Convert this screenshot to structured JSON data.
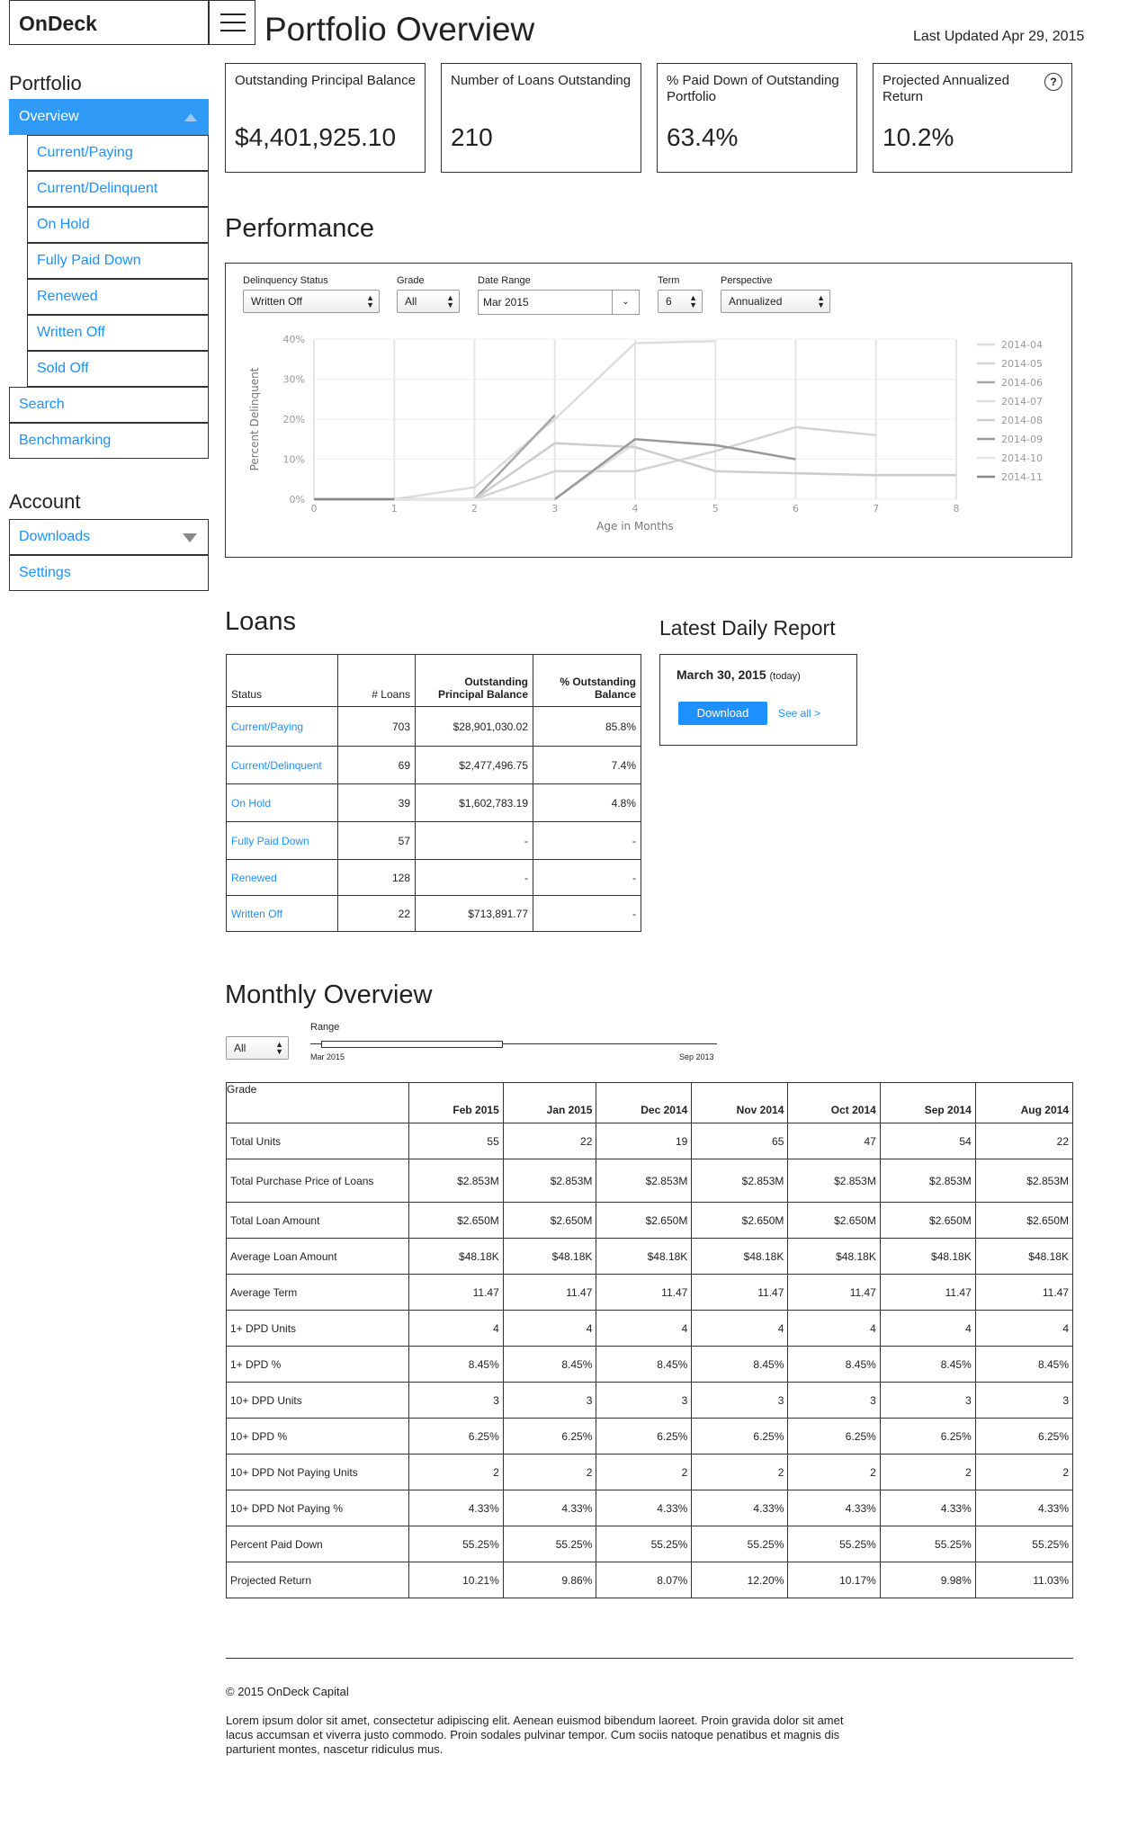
{
  "header": {
    "logo": "OnDeck",
    "title": "Portfolio Overview",
    "last_updated": "Last Updated Apr 29, 2015"
  },
  "sidebar": {
    "portfolio_heading": "Portfolio",
    "overview": "Overview",
    "sub_items": [
      "Current/Paying",
      "Current/Delinquent",
      "On Hold",
      "Fully Paid Down",
      "Renewed",
      "Written Off",
      "Sold Off"
    ],
    "search": "Search",
    "benchmarking": "Benchmarking",
    "account_heading": "Account",
    "downloads": "Downloads",
    "settings": "Settings"
  },
  "metrics": [
    {
      "label": "Outstanding Principal Balance",
      "value": "$4,401,925.10"
    },
    {
      "label": "Number of Loans Outstanding",
      "value": "210"
    },
    {
      "label": "% Paid Down of Outstanding Portfolio",
      "value": "63.4%"
    },
    {
      "label": "Projected Annualized Return",
      "value": "10.2%"
    }
  ],
  "help_glyph": "?",
  "performance": {
    "title": "Performance",
    "filters": {
      "delinquency_label": "Delinquency Status",
      "delinquency_value": "Written Off",
      "grade_label": "Grade",
      "grade_value": "All",
      "date_label": "Date Range",
      "date_value": "Mar 2015",
      "term_label": "Term",
      "term_value": "6",
      "perspective_label": "Perspective",
      "perspective_value": "Annualized"
    }
  },
  "chart_data": {
    "type": "line",
    "xlabel": "Age in Months",
    "ylabel": "Percent Delinquent",
    "x": [
      0,
      1,
      2,
      3,
      4,
      5,
      6,
      7,
      8
    ],
    "xlim": [
      0,
      8
    ],
    "ylim": [
      0,
      40
    ],
    "yticks": [
      "0%",
      "10%",
      "20%",
      "30%",
      "40%"
    ],
    "grid": true,
    "legend": "right",
    "series": [
      {
        "name": "2014-04",
        "color": "#dddddd",
        "values": [
          0,
          0,
          3,
          20,
          39,
          39.5
        ]
      },
      {
        "name": "2014-05",
        "color": "#d4d4d4",
        "values": [
          0,
          0,
          0,
          7,
          7,
          12,
          18,
          16
        ]
      },
      {
        "name": "2014-06",
        "color": "#a8a8a8",
        "values": [
          0,
          0,
          0,
          21
        ]
      },
      {
        "name": "2014-07",
        "color": "#e0e0e0",
        "values": [
          0,
          0,
          0,
          0,
          14
        ]
      },
      {
        "name": "2014-08",
        "color": "#cccccc",
        "values": [
          0,
          0,
          0,
          14,
          13,
          7,
          6.5,
          6,
          6
        ]
      },
      {
        "name": "2014-09",
        "color": "#999999",
        "values": [
          0,
          0,
          0,
          0,
          15,
          13.5,
          10
        ]
      },
      {
        "name": "2014-10",
        "color": "#e6e6e6",
        "values": [
          0,
          0,
          0,
          0
        ]
      },
      {
        "name": "2014-11",
        "color": "#888888",
        "values": [
          0,
          0
        ]
      }
    ]
  },
  "loans": {
    "title": "Loans",
    "headers": [
      "Status",
      "# Loans",
      "Outstanding Principal Balance",
      "% Outstanding Balance"
    ],
    "rows": [
      [
        "Current/Paying",
        "703",
        "$28,901,030.02",
        "85.8%"
      ],
      [
        "Current/Delinquent",
        "69",
        "$2,477,496.75",
        "7.4%"
      ],
      [
        "On Hold",
        "39",
        "$1,602,783.19",
        "4.8%"
      ],
      [
        "Fully Paid Down",
        "57",
        "-",
        "-"
      ],
      [
        "Renewed",
        "128",
        "-",
        "-"
      ],
      [
        "Written Off",
        "22",
        "$713,891.77",
        "-"
      ]
    ]
  },
  "daily_report": {
    "title": "Latest Daily Report",
    "date": "March 30, 2015",
    "today": "(today)",
    "download": "Download",
    "see_all": "See all >"
  },
  "monthly": {
    "title": "Monthly Overview",
    "grade_select": "All",
    "range_label": "Range",
    "range_start": "Mar 2015",
    "range_end": "Sep 2013",
    "range_selected_fraction": 0.48,
    "grade_header": "Grade",
    "months": [
      "Feb 2015",
      "Jan 2015",
      "Dec 2014",
      "Nov 2014",
      "Oct 2014",
      "Sep 2014",
      "Aug 2014"
    ],
    "rows": [
      {
        "label": "Total Units",
        "values": [
          "55",
          "22",
          "19",
          "65",
          "47",
          "54",
          "22"
        ]
      },
      {
        "label": "Total Purchase Price of Loans",
        "values": [
          "$2.853M",
          "$2.853M",
          "$2.853M",
          "$2.853M",
          "$2.853M",
          "$2.853M",
          "$2.853M"
        ]
      },
      {
        "label": "Total Loan Amount",
        "values": [
          "$2.650M",
          "$2.650M",
          "$2.650M",
          "$2.650M",
          "$2.650M",
          "$2.650M",
          "$2.650M"
        ]
      },
      {
        "label": "Average Loan Amount",
        "values": [
          "$48.18K",
          "$48.18K",
          "$48.18K",
          "$48.18K",
          "$48.18K",
          "$48.18K",
          "$48.18K"
        ]
      },
      {
        "label": "Average Term",
        "values": [
          "11.47",
          "11.47",
          "11.47",
          "11.47",
          "11.47",
          "11.47",
          "11.47"
        ]
      },
      {
        "label": "1+ DPD Units",
        "values": [
          "4",
          "4",
          "4",
          "4",
          "4",
          "4",
          "4"
        ]
      },
      {
        "label": "1+ DPD %",
        "values": [
          "8.45%",
          "8.45%",
          "8.45%",
          "8.45%",
          "8.45%",
          "8.45%",
          "8.45%"
        ]
      },
      {
        "label": "10+ DPD Units",
        "values": [
          "3",
          "3",
          "3",
          "3",
          "3",
          "3",
          "3"
        ]
      },
      {
        "label": "10+ DPD %",
        "values": [
          "6.25%",
          "6.25%",
          "6.25%",
          "6.25%",
          "6.25%",
          "6.25%",
          "6.25%"
        ]
      },
      {
        "label": "10+ DPD Not Paying Units",
        "values": [
          "2",
          "2",
          "2",
          "2",
          "2",
          "2",
          "2"
        ]
      },
      {
        "label": "10+ DPD Not Paying %",
        "values": [
          "4.33%",
          "4.33%",
          "4.33%",
          "4.33%",
          "4.33%",
          "4.33%",
          "4.33%"
        ]
      },
      {
        "label": "Percent Paid Down",
        "values": [
          "55.25%",
          "55.25%",
          "55.25%",
          "55.25%",
          "55.25%",
          "55.25%",
          "55.25%"
        ]
      },
      {
        "label": "Projected Return",
        "values": [
          "10.21%",
          "9.86%",
          "8.07%",
          "12.20%",
          "10.17%",
          "9.98%",
          "11.03%"
        ]
      }
    ]
  },
  "footer": {
    "copyright": "© 2015 OnDeck Capital",
    "text": "Lorem ipsum dolor sit amet, consectetur adipiscing elit. Aenean euismod bibendum laoreet. Proin gravida dolor sit amet lacus accumsan et viverra justo commodo. Proin sodales pulvinar tempor. Cum sociis natoque penatibus et magnis dis parturient montes, nascetur ridiculus mus."
  }
}
